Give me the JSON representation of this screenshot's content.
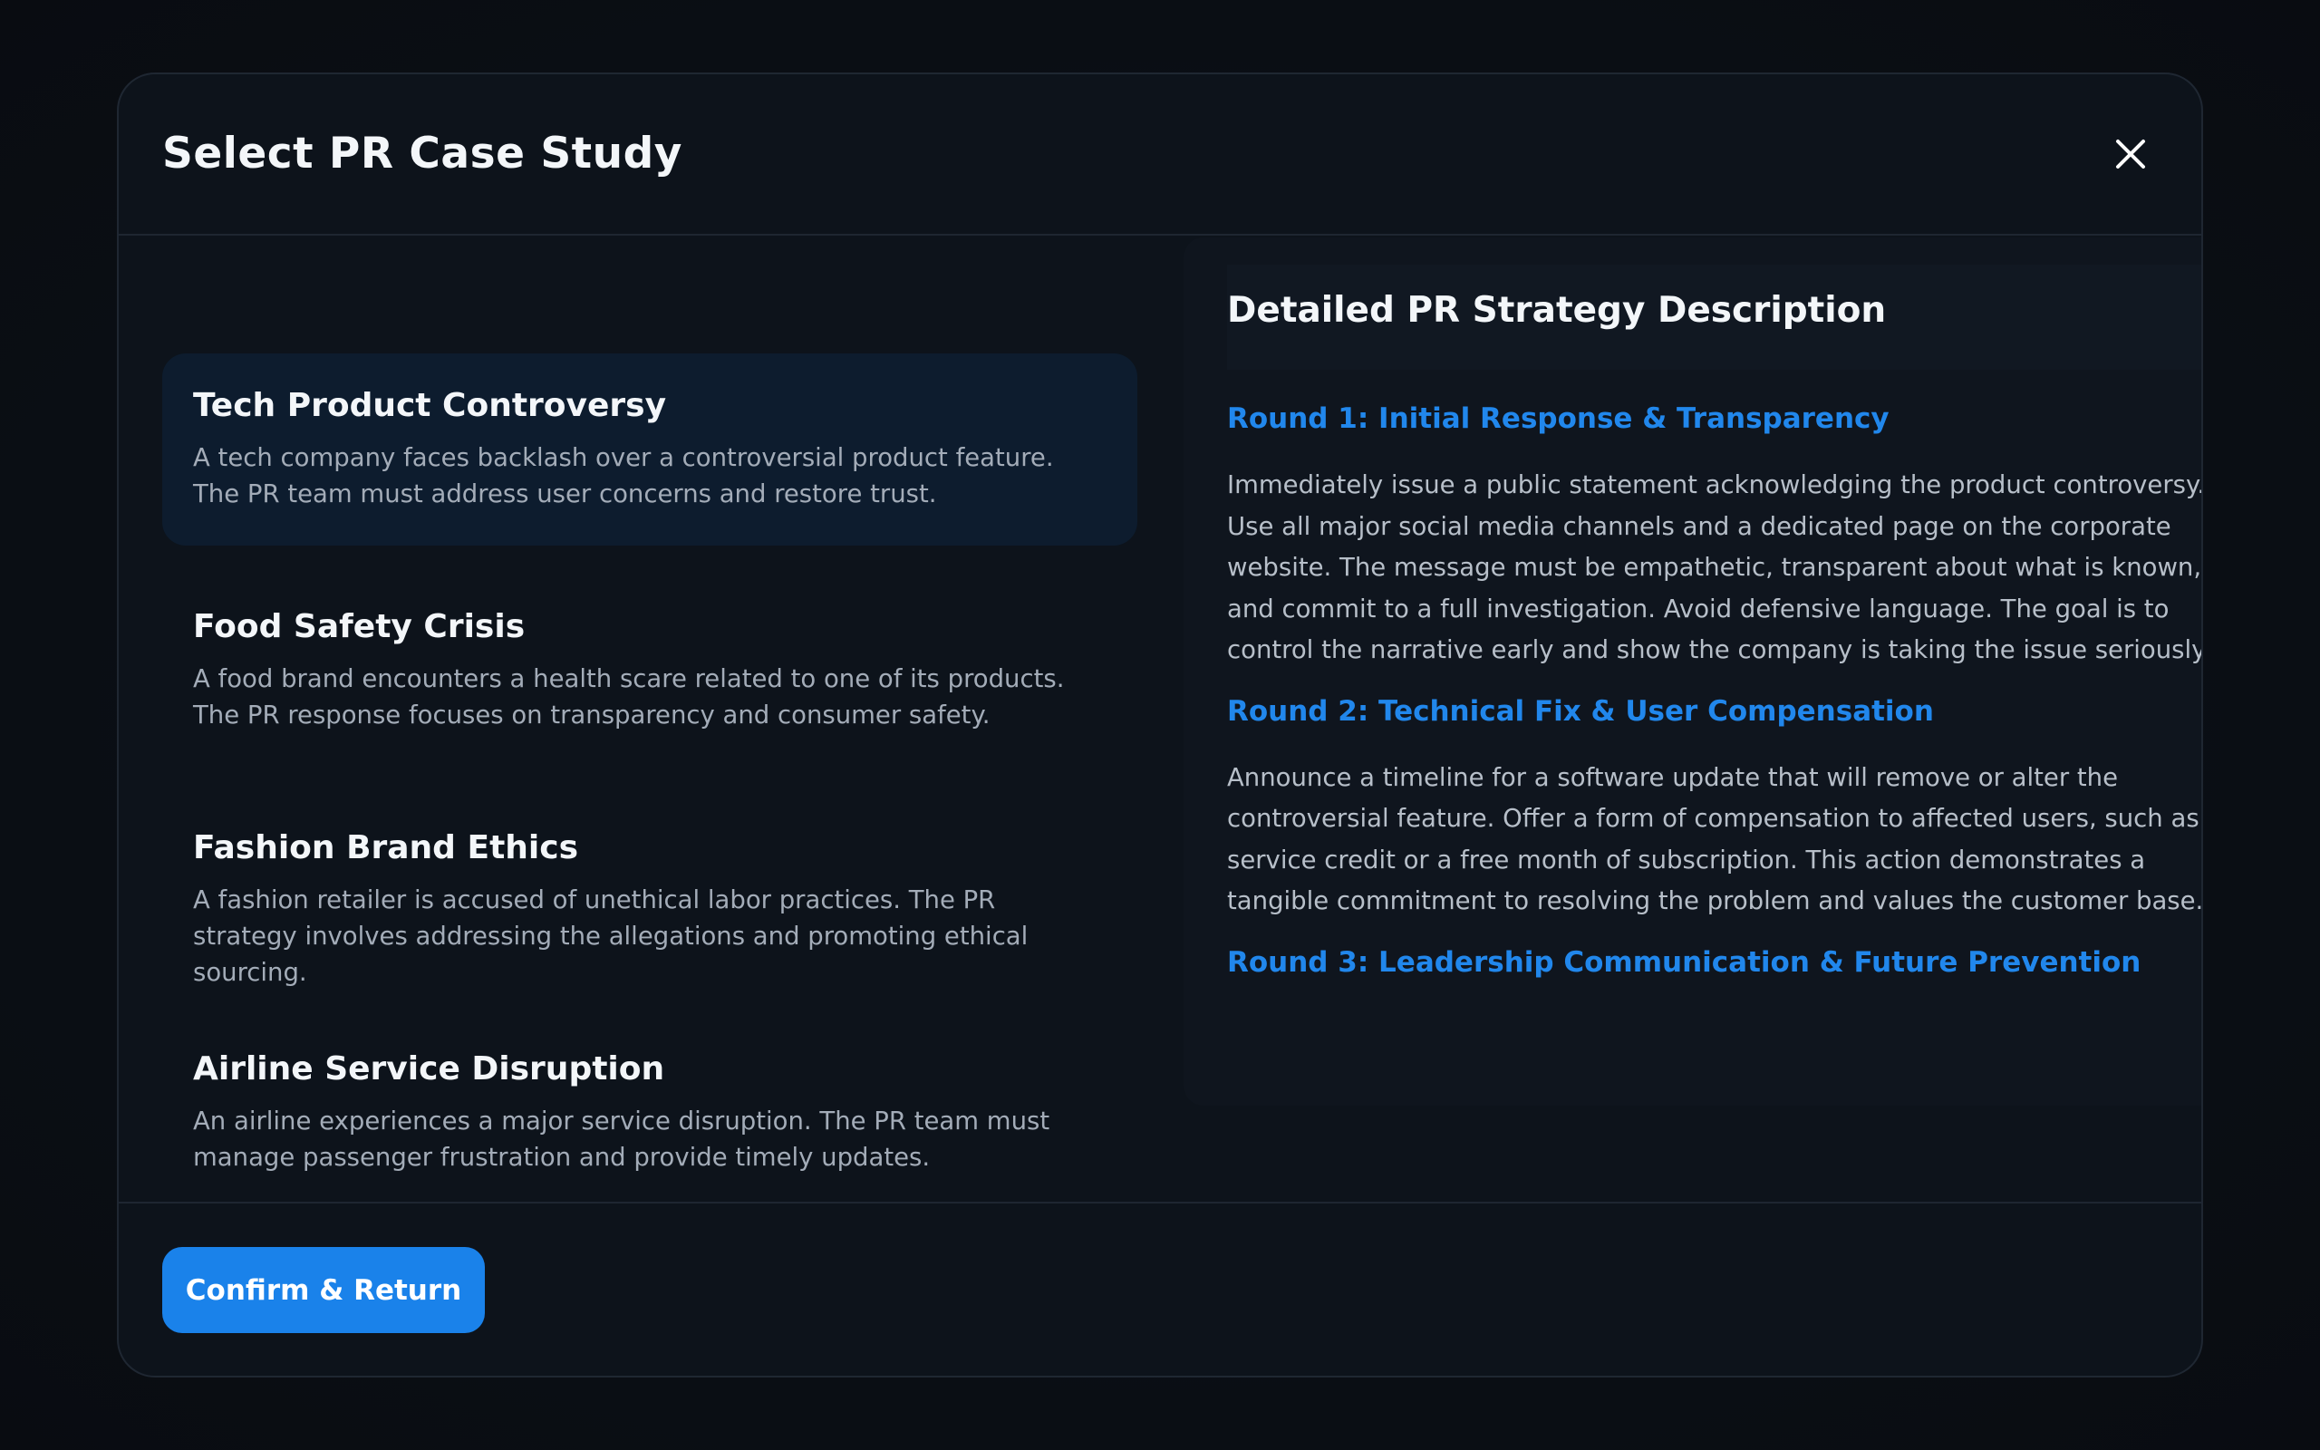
{
  "modal": {
    "title": "Select PR Case Study",
    "close_icon": "close-icon"
  },
  "cases": [
    {
      "title": "Tech Product Controversy",
      "description": "A tech company faces backlash over a controversial product feature. The PR team must address user concerns and restore trust.",
      "selected": true
    },
    {
      "title": "Food Safety Crisis",
      "description": "A food brand encounters a health scare related to one of its products. The PR response focuses on transparency and consumer safety.",
      "selected": false
    },
    {
      "title": "Fashion Brand Ethics",
      "description": "A fashion retailer is accused of unethical labor practices. The PR strategy involves addressing the allegations and promoting ethical sourcing.",
      "selected": false
    },
    {
      "title": "Airline Service Disruption",
      "description": "An airline experiences a major service disruption. The PR team must manage passenger frustration and provide timely updates.",
      "selected": false
    }
  ],
  "detail": {
    "heading": "Detailed PR Strategy Description",
    "rounds": [
      {
        "title": "Round 1: Initial Response & Transparency",
        "body": "Immediately issue a public statement acknowledging the product controversy. Use all major social media channels and a dedicated page on the corporate website. The message must be empathetic, transparent about what is known, and commit to a full investigation. Avoid defensive language. The goal is to control the narrative early and show the company is taking the issue seriously."
      },
      {
        "title": "Round 2: Technical Fix & User Compensation",
        "body": "Announce a timeline for a software update that will remove or alter the controversial feature. Offer a form of compensation to affected users, such as a service credit or a free month of subscription. This action demonstrates a tangible commitment to resolving the problem and values the customer base."
      },
      {
        "title": "Round 3: Leadership Communication & Future Prevention",
        "body": ""
      }
    ]
  },
  "footer": {
    "confirm_label": "Confirm & Return"
  },
  "colors": {
    "accent": "#1a82ea",
    "round_title": "#2187ec",
    "selected_bg": "#0d1c2e"
  }
}
